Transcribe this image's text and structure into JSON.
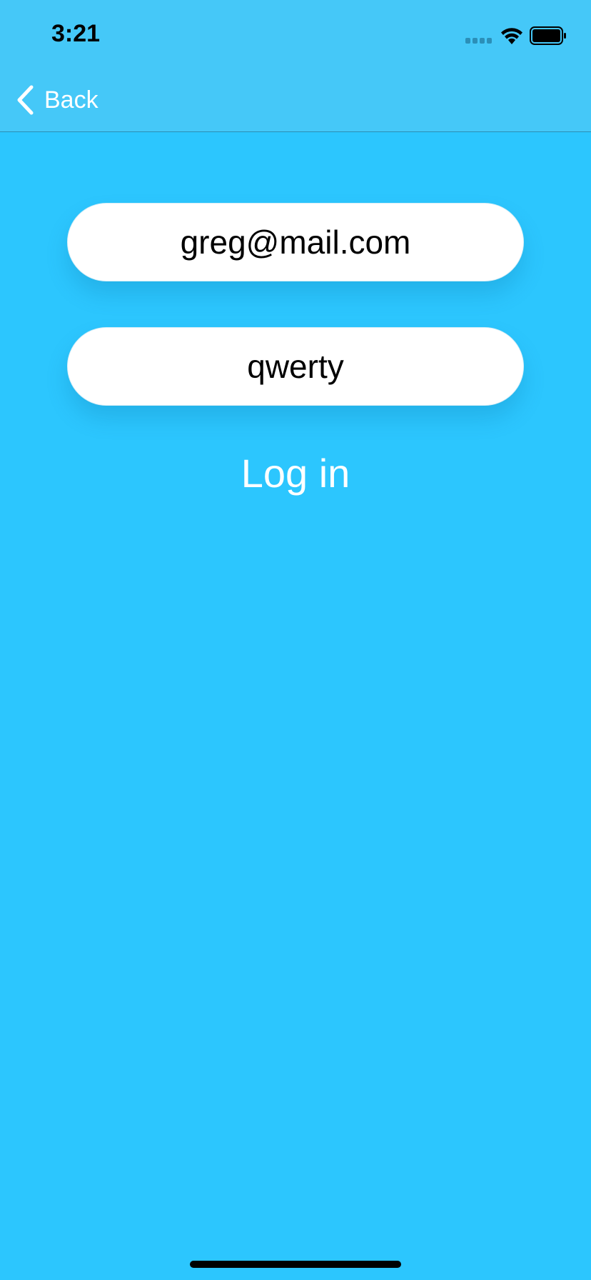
{
  "status_bar": {
    "time": "3:21",
    "icons": [
      "cellular-signal-icon",
      "wifi-icon",
      "battery-icon"
    ]
  },
  "nav": {
    "back_label": "Back",
    "back_icon": "chevron-left-icon"
  },
  "form": {
    "email_value": "greg@mail.com",
    "password_value": "qwerty",
    "login_label": "Log in"
  },
  "colors": {
    "background": "#2cc6fe",
    "nav_bar": "#45c8f8",
    "field": "#ffffff",
    "text_light": "#ffffff"
  }
}
